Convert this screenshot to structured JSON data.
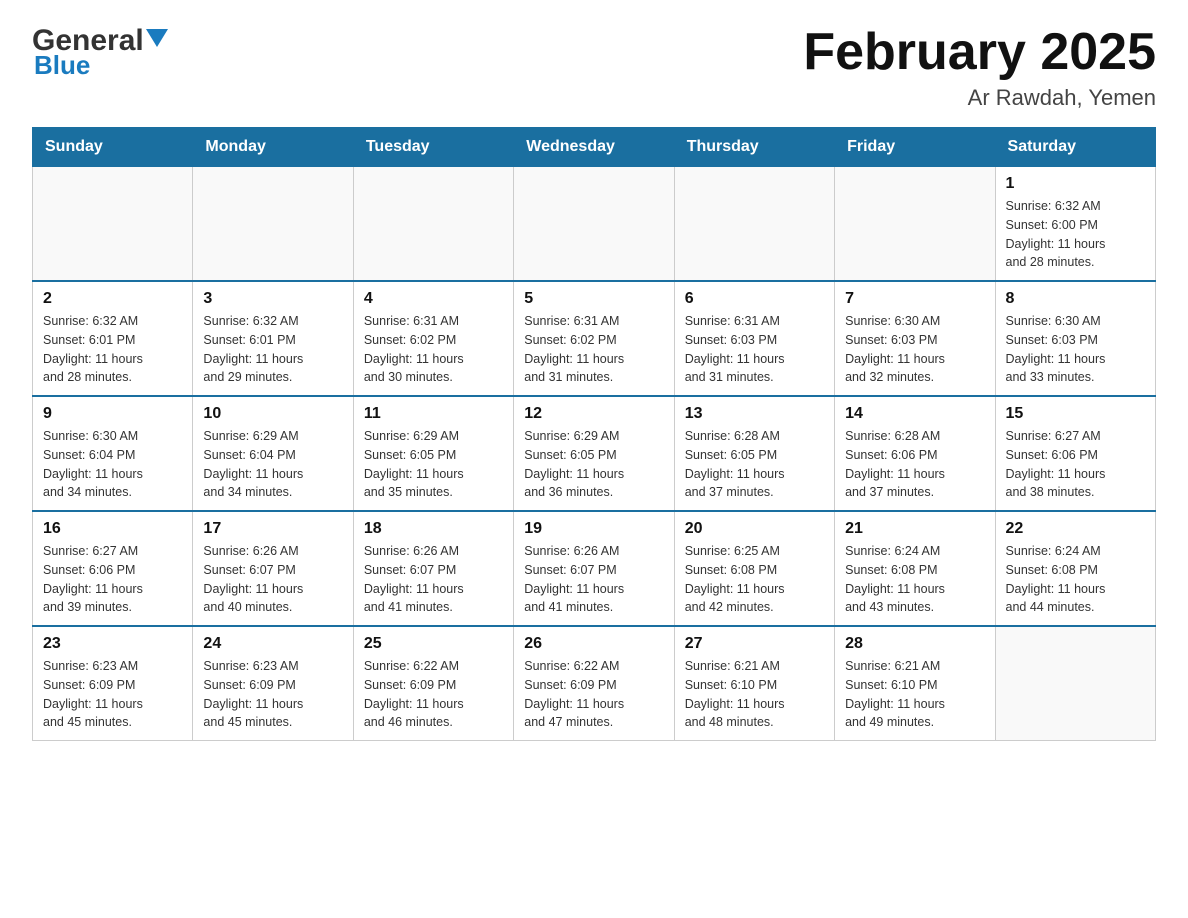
{
  "logo": {
    "general": "General",
    "blue": "Blue",
    "triangle_color": "#1a7bbf"
  },
  "header": {
    "title": "February 2025",
    "subtitle": "Ar Rawdah, Yemen"
  },
  "weekdays": [
    "Sunday",
    "Monday",
    "Tuesday",
    "Wednesday",
    "Thursday",
    "Friday",
    "Saturday"
  ],
  "weeks": [
    [
      {
        "day": "",
        "info": ""
      },
      {
        "day": "",
        "info": ""
      },
      {
        "day": "",
        "info": ""
      },
      {
        "day": "",
        "info": ""
      },
      {
        "day": "",
        "info": ""
      },
      {
        "day": "",
        "info": ""
      },
      {
        "day": "1",
        "info": "Sunrise: 6:32 AM\nSunset: 6:00 PM\nDaylight: 11 hours\nand 28 minutes."
      }
    ],
    [
      {
        "day": "2",
        "info": "Sunrise: 6:32 AM\nSunset: 6:01 PM\nDaylight: 11 hours\nand 28 minutes."
      },
      {
        "day": "3",
        "info": "Sunrise: 6:32 AM\nSunset: 6:01 PM\nDaylight: 11 hours\nand 29 minutes."
      },
      {
        "day": "4",
        "info": "Sunrise: 6:31 AM\nSunset: 6:02 PM\nDaylight: 11 hours\nand 30 minutes."
      },
      {
        "day": "5",
        "info": "Sunrise: 6:31 AM\nSunset: 6:02 PM\nDaylight: 11 hours\nand 31 minutes."
      },
      {
        "day": "6",
        "info": "Sunrise: 6:31 AM\nSunset: 6:03 PM\nDaylight: 11 hours\nand 31 minutes."
      },
      {
        "day": "7",
        "info": "Sunrise: 6:30 AM\nSunset: 6:03 PM\nDaylight: 11 hours\nand 32 minutes."
      },
      {
        "day": "8",
        "info": "Sunrise: 6:30 AM\nSunset: 6:03 PM\nDaylight: 11 hours\nand 33 minutes."
      }
    ],
    [
      {
        "day": "9",
        "info": "Sunrise: 6:30 AM\nSunset: 6:04 PM\nDaylight: 11 hours\nand 34 minutes."
      },
      {
        "day": "10",
        "info": "Sunrise: 6:29 AM\nSunset: 6:04 PM\nDaylight: 11 hours\nand 34 minutes."
      },
      {
        "day": "11",
        "info": "Sunrise: 6:29 AM\nSunset: 6:05 PM\nDaylight: 11 hours\nand 35 minutes."
      },
      {
        "day": "12",
        "info": "Sunrise: 6:29 AM\nSunset: 6:05 PM\nDaylight: 11 hours\nand 36 minutes."
      },
      {
        "day": "13",
        "info": "Sunrise: 6:28 AM\nSunset: 6:05 PM\nDaylight: 11 hours\nand 37 minutes."
      },
      {
        "day": "14",
        "info": "Sunrise: 6:28 AM\nSunset: 6:06 PM\nDaylight: 11 hours\nand 37 minutes."
      },
      {
        "day": "15",
        "info": "Sunrise: 6:27 AM\nSunset: 6:06 PM\nDaylight: 11 hours\nand 38 minutes."
      }
    ],
    [
      {
        "day": "16",
        "info": "Sunrise: 6:27 AM\nSunset: 6:06 PM\nDaylight: 11 hours\nand 39 minutes."
      },
      {
        "day": "17",
        "info": "Sunrise: 6:26 AM\nSunset: 6:07 PM\nDaylight: 11 hours\nand 40 minutes."
      },
      {
        "day": "18",
        "info": "Sunrise: 6:26 AM\nSunset: 6:07 PM\nDaylight: 11 hours\nand 41 minutes."
      },
      {
        "day": "19",
        "info": "Sunrise: 6:26 AM\nSunset: 6:07 PM\nDaylight: 11 hours\nand 41 minutes."
      },
      {
        "day": "20",
        "info": "Sunrise: 6:25 AM\nSunset: 6:08 PM\nDaylight: 11 hours\nand 42 minutes."
      },
      {
        "day": "21",
        "info": "Sunrise: 6:24 AM\nSunset: 6:08 PM\nDaylight: 11 hours\nand 43 minutes."
      },
      {
        "day": "22",
        "info": "Sunrise: 6:24 AM\nSunset: 6:08 PM\nDaylight: 11 hours\nand 44 minutes."
      }
    ],
    [
      {
        "day": "23",
        "info": "Sunrise: 6:23 AM\nSunset: 6:09 PM\nDaylight: 11 hours\nand 45 minutes."
      },
      {
        "day": "24",
        "info": "Sunrise: 6:23 AM\nSunset: 6:09 PM\nDaylight: 11 hours\nand 45 minutes."
      },
      {
        "day": "25",
        "info": "Sunrise: 6:22 AM\nSunset: 6:09 PM\nDaylight: 11 hours\nand 46 minutes."
      },
      {
        "day": "26",
        "info": "Sunrise: 6:22 AM\nSunset: 6:09 PM\nDaylight: 11 hours\nand 47 minutes."
      },
      {
        "day": "27",
        "info": "Sunrise: 6:21 AM\nSunset: 6:10 PM\nDaylight: 11 hours\nand 48 minutes."
      },
      {
        "day": "28",
        "info": "Sunrise: 6:21 AM\nSunset: 6:10 PM\nDaylight: 11 hours\nand 49 minutes."
      },
      {
        "day": "",
        "info": ""
      }
    ]
  ]
}
